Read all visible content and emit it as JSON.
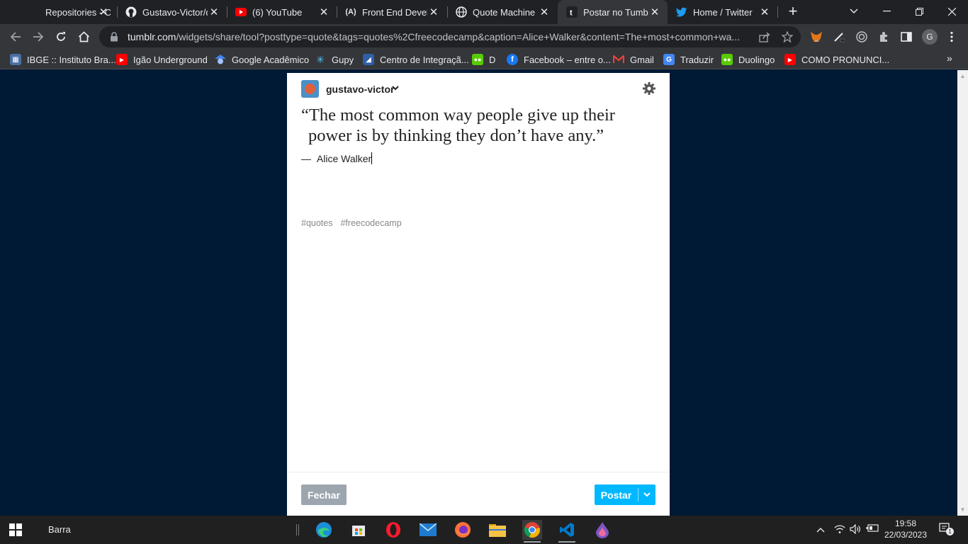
{
  "browser": {
    "tabs": [
      {
        "title": "Repositories - Co",
        "icon": "github-repositories-icon"
      },
      {
        "title": "Gustavo-Victor/q",
        "icon": "github-icon"
      },
      {
        "title": "(6) YouTube",
        "icon": "youtube-icon"
      },
      {
        "title": "Front End Develo",
        "icon": "freecodecamp-icon"
      },
      {
        "title": "Quote Machine",
        "icon": "globe-icon"
      },
      {
        "title": "Postar no Tumblr",
        "icon": "tumblr-icon"
      },
      {
        "title": "Home / Twitter",
        "icon": "twitter-icon"
      }
    ],
    "active_tab_index": 5,
    "url_domain": "tumblr.com",
    "url_path": "/widgets/share/tool?posttype=quote&tags=quotes%2Cfreecodecamp&caption=Alice+Walker&content=The+most+common+wa...",
    "profile_initial": "G",
    "bookmarks": [
      {
        "label": "IBGE :: Instituto Bra...",
        "icon": "ibge-icon"
      },
      {
        "label": "Igão Underground",
        "icon": "youtube-icon"
      },
      {
        "label": "Google Acadêmico",
        "icon": "google-scholar-icon"
      },
      {
        "label": "Gupy",
        "icon": "gupy-icon"
      },
      {
        "label": "Centro de Integraçã...",
        "icon": "ciee-icon"
      },
      {
        "label": "D",
        "icon": "duolingo-icon"
      },
      {
        "label": "Facebook – entre o...",
        "icon": "facebook-icon"
      },
      {
        "label": "Gmail",
        "icon": "gmail-icon"
      },
      {
        "label": "Traduzir",
        "icon": "translate-icon"
      },
      {
        "label": "Duolingo",
        "icon": "duolingo-icon"
      },
      {
        "label": "COMO PRONUNCI...",
        "icon": "youtube-icon"
      }
    ],
    "bookmarks_more": "»"
  },
  "tumblr": {
    "blog_name": "gustavo-victor",
    "quote_line1": "“The most common way people give up their",
    "quote_line2": "power is by thinking they don’t have any.”",
    "attribution_dash": "—",
    "attribution": "Alice Walker",
    "tags": [
      "#quotes",
      "#freecodecamp"
    ],
    "close_label": "Fechar",
    "post_label": "Postar"
  },
  "taskbar": {
    "search_label": "Barra",
    "time": "19:58",
    "date": "22/03/2023",
    "notification_count": "1",
    "apps": [
      "edge-icon",
      "store-icon",
      "opera-icon",
      "mail-icon",
      "firefox-icon",
      "file-explorer-icon",
      "chrome-icon",
      "vscode-icon",
      "drop-app-icon"
    ]
  },
  "colors": {
    "page_background": "#001935",
    "post_button": "#00b8ff",
    "close_button": "#9da6af",
    "chrome_dark": "#202124",
    "chrome_toolbar": "#35363a"
  }
}
